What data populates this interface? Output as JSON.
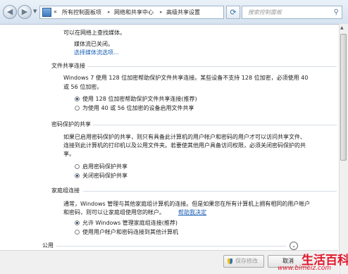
{
  "address_bar": {
    "breadcrumbs": [
      "«",
      "所有控制面板项",
      "网络和共享中心",
      "高级共享设置"
    ],
    "search_placeholder": "搜索控制面板"
  },
  "content": {
    "top": {
      "line1": "可以在网络上查找媒体。",
      "media_status": "媒体流已关闭。",
      "media_link": "选择媒体流选项..."
    },
    "file_sharing": {
      "title": "文件共享连接",
      "desc1": "Windows 7 使用 128 位加密帮助保护文件共享连接。某些设备不支持 128 位加密，必须使用 40",
      "desc2": "或 56 位加密。",
      "options": [
        {
          "label": "使用 128 位加密帮助保护文件共享连接(推荐)",
          "checked": true
        },
        {
          "label": "为使用 40 或 56 位加密的设备启用文件共享",
          "checked": false
        }
      ]
    },
    "password_sharing": {
      "title": "密码保护的共享",
      "desc1": "如果已启用密码保护的共享，则只有具备此计算机的用户帐户和密码的用户才可以访问共享文件、",
      "desc2": "连接到此计算机的打印机以及公用文件夹。若要使其他用户具备访问权限，必须关闭密码保护的共",
      "desc3": "享。",
      "options": [
        {
          "label": "启用密码保护共享",
          "checked": false
        },
        {
          "label": "关闭密码保护共享",
          "checked": true
        }
      ]
    },
    "homegroup": {
      "title": "家庭组连接",
      "desc1": "通常，Windows 管理与其他家庭组计算机的连接。但是如果您在所有计算机上拥有相同的用户帐户",
      "desc2": "和密码，则可以让家庭组使用您的帐户。",
      "desc_link": "帮助我决定",
      "options": [
        {
          "label": "允许 Windows 管理家庭组连接(推荐)",
          "checked": true
        },
        {
          "label": "使用用户帐户和密码连接到其他计算机",
          "checked": false
        }
      ]
    },
    "public": {
      "title": "公用"
    }
  },
  "footer": {
    "save_label": "保存修改",
    "cancel_label": "取消"
  },
  "watermark": {
    "brand": "生活百科",
    "url": "www.bimeiz.com"
  }
}
